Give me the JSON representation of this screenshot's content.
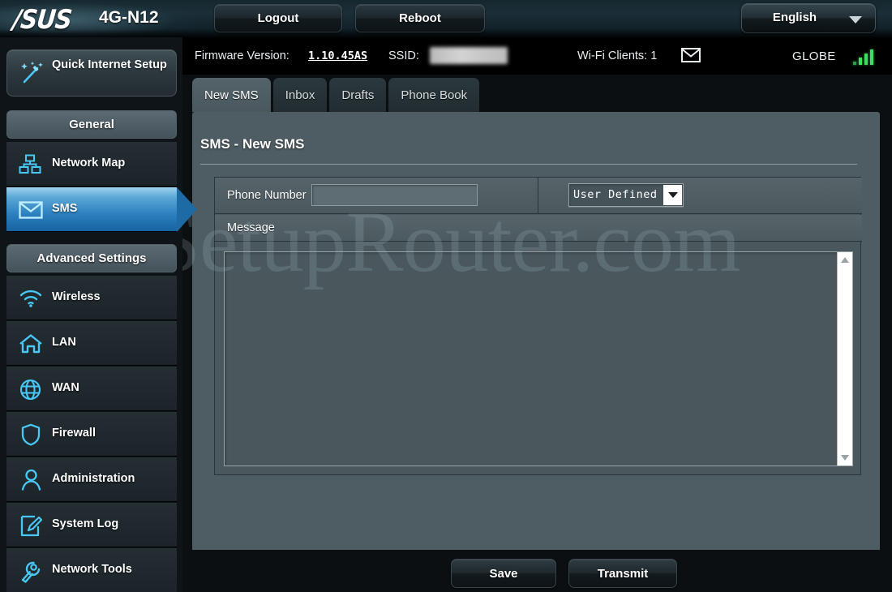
{
  "header": {
    "brand": "/SUS",
    "model": "4G-N12",
    "logout_label": "Logout",
    "reboot_label": "Reboot",
    "language": "English",
    "language_icon": "chevron-down-icon"
  },
  "status": {
    "firmware_label": "Firmware Version:",
    "firmware_value": "1.10.45AS",
    "ssid_label": "SSID:",
    "ssid_value": "",
    "clients_label": "Wi-Fi Clients: 1",
    "mail_icon": "envelope-icon",
    "carrier": "GLOBE",
    "signal_icon": "signal-bars-icon",
    "signal_bars": 4
  },
  "tabs": [
    {
      "label": "New SMS",
      "active": true
    },
    {
      "label": "Inbox",
      "active": false
    },
    {
      "label": "Drafts",
      "active": false
    },
    {
      "label": "Phone Book",
      "active": false
    }
  ],
  "page": {
    "title": "SMS - New SMS",
    "watermark": "SetupRouter.com"
  },
  "form": {
    "phone_label": "Phone Number",
    "phone_value": "",
    "phone_placeholder": "",
    "recipient_select": "User Defined",
    "recipient_select_icon": "chevron-down-icon",
    "message_label": "Message",
    "message_value": "",
    "scrollbar_up_icon": "chevron-up-icon",
    "scrollbar_down_icon": "chevron-down-icon"
  },
  "actions": {
    "save_label": "Save",
    "transmit_label": "Transmit"
  },
  "sidebar": {
    "quick_setup": {
      "label": "Quick Internet Setup",
      "icon": "magic-wand-icon"
    },
    "general_header": "General",
    "general_items": [
      {
        "label": "Network Map",
        "icon": "network-map-icon",
        "active": false
      },
      {
        "label": "SMS",
        "icon": "envelope-icon",
        "active": true
      }
    ],
    "advanced_header": "Advanced Settings",
    "advanced_items": [
      {
        "label": "Wireless",
        "icon": "wifi-icon"
      },
      {
        "label": "LAN",
        "icon": "house-icon"
      },
      {
        "label": "WAN",
        "icon": "globe-icon"
      },
      {
        "label": "Firewall",
        "icon": "shield-icon"
      },
      {
        "label": "Administration",
        "icon": "user-icon"
      },
      {
        "label": "System Log",
        "icon": "pencil-document-icon"
      },
      {
        "label": "Network Tools",
        "icon": "wrench-icon"
      }
    ]
  },
  "colors": {
    "accent_blue": "#2b7fbe",
    "icon_cyan": "#49c8f5",
    "panel": "#4e5d63",
    "signal_green": "#3fdc62"
  }
}
